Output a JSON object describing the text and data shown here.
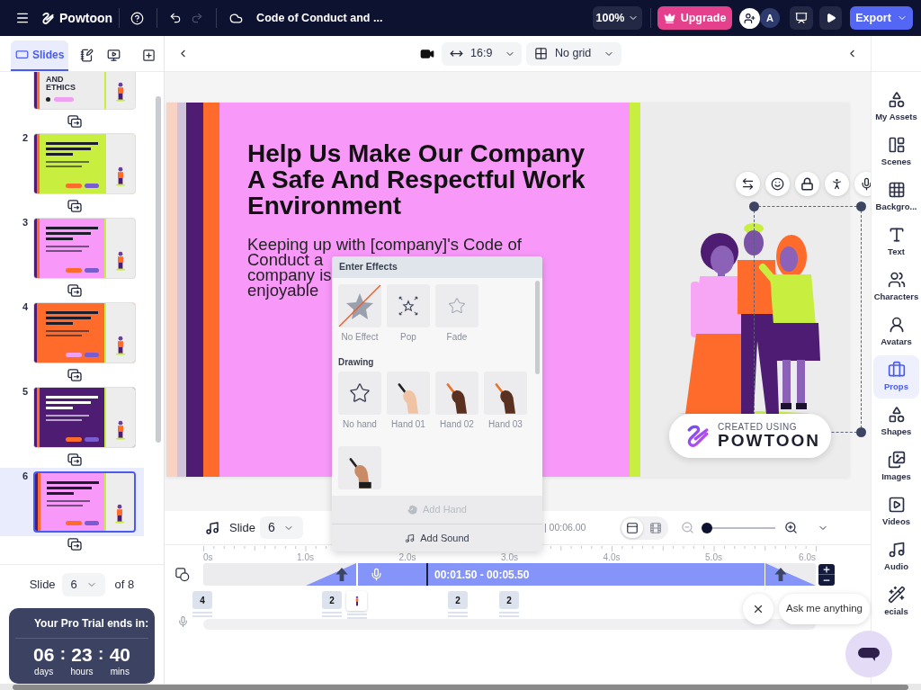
{
  "top_bar": {
    "app_name": "Powtoon",
    "document_title": "Code of Conduct and ...",
    "zoom": "100%",
    "upgrade": "Upgrade",
    "avatar": "A",
    "export": "Export"
  },
  "left_tabs": [
    {
      "kind": "slides",
      "label": "Slides",
      "selected": true
    },
    {
      "kind": "notes",
      "selected": false
    },
    {
      "kind": "record",
      "selected": false
    },
    {
      "kind": "add",
      "selected": false
    }
  ],
  "slides": [
    {
      "heading": "AND ETHICS",
      "color": "#ececec",
      "selected": false
    },
    {
      "number": "2",
      "color": "#c8ef3f",
      "selected": false
    },
    {
      "number": "3",
      "color": "#f899fa",
      "selected": false
    },
    {
      "number": "4",
      "color": "#ff6b2b",
      "selected": false
    },
    {
      "number": "5",
      "color": "#4f1c74",
      "selected": false
    },
    {
      "number": "6",
      "color": "#f899fa",
      "selected": true
    }
  ],
  "slide_picker": {
    "label": "Slide",
    "value": "6",
    "total": "of 8"
  },
  "trial": {
    "title": "Your Pro Trial ends in:",
    "units": [
      {
        "value": "06",
        "label": "days"
      },
      {
        "value": "23",
        "label": "hours"
      },
      {
        "value": "40",
        "label": "mins"
      }
    ],
    "separators": [
      ":",
      ":"
    ]
  },
  "canvas_toolbar": {
    "aspect": "16:9",
    "grid": "No grid"
  },
  "slide": {
    "title_lines": [
      "Help Us Make Our Company",
      "A Safe And Respectful Work",
      "Environment"
    ],
    "body_lines": [
      "Keeping up with [company]'s Code of",
      "Conduct a",
      "company is",
      "enjoyable"
    ],
    "element_tools": [
      {
        "kind": "swap"
      },
      {
        "kind": "face"
      },
      {
        "kind": "lock"
      },
      {
        "kind": "pose"
      },
      {
        "kind": "mic"
      }
    ],
    "badge": {
      "top": "CREATED USING",
      "bottom": "POWTOON"
    }
  },
  "effects_popup": {
    "title": "Enter Effects",
    "effects": [
      {
        "kind": "none",
        "label": "No Effect"
      },
      {
        "kind": "pop",
        "label": "Pop"
      },
      {
        "kind": "fade",
        "label": "Fade"
      }
    ],
    "section": "Drawing",
    "hands": [
      {
        "kind": "star",
        "label": "No hand"
      },
      {
        "kind": "light",
        "label": "Hand 01"
      },
      {
        "kind": "dark",
        "label": "Hand 02"
      },
      {
        "kind": "dark",
        "label": "Hand 03"
      },
      {
        "kind": "cuff"
      }
    ],
    "actions": [
      {
        "kind": "hand",
        "label": "Add Hand",
        "disabled": true
      },
      {
        "kind": "sound",
        "label": "Add Sound",
        "disabled": false
      }
    ]
  },
  "right_sidebar": [
    {
      "kind": "assets",
      "label": "My Assets",
      "selected": false
    },
    {
      "kind": "scenes",
      "label": "Scenes",
      "selected": false
    },
    {
      "kind": "backgrounds",
      "label": "Backgro...",
      "selected": false
    },
    {
      "kind": "text",
      "label": "Text",
      "selected": false
    },
    {
      "kind": "characters",
      "label": "Characters",
      "selected": false
    },
    {
      "kind": "avatars",
      "label": "Avatars",
      "selected": false
    },
    {
      "kind": "props",
      "label": "Props",
      "selected": true
    },
    {
      "kind": "shapes",
      "label": "Shapes",
      "selected": false
    },
    {
      "kind": "images",
      "label": "Images",
      "selected": false
    },
    {
      "kind": "videos",
      "label": "Videos",
      "selected": false
    },
    {
      "kind": "audio",
      "label": "Audio",
      "selected": false
    },
    {
      "kind": "specials",
      "label": "ecials",
      "selected": false
    }
  ],
  "timeline": {
    "slide_label": "Slide",
    "slide_value": "6",
    "duration": "| 00:06.00",
    "views": [
      {
        "kind": "single",
        "selected": true
      },
      {
        "kind": "strip",
        "selected": false
      }
    ],
    "zoom": {
      "level": 0
    },
    "ruler": [
      "0s",
      "1.0s",
      "2.0s",
      "3.0s",
      "4.0s",
      "5.0s",
      "6.0s"
    ],
    "clip": "00:01.50 - 00:05.50",
    "markers": [
      {
        "kind": "count",
        "label": "4"
      },
      {
        "kind": "count",
        "label": "2"
      },
      {
        "kind": "character"
      },
      {
        "kind": "count",
        "label": "2"
      },
      {
        "kind": "count",
        "label": "2"
      }
    ]
  },
  "assistant": {
    "prompt": "Ask me anything"
  }
}
